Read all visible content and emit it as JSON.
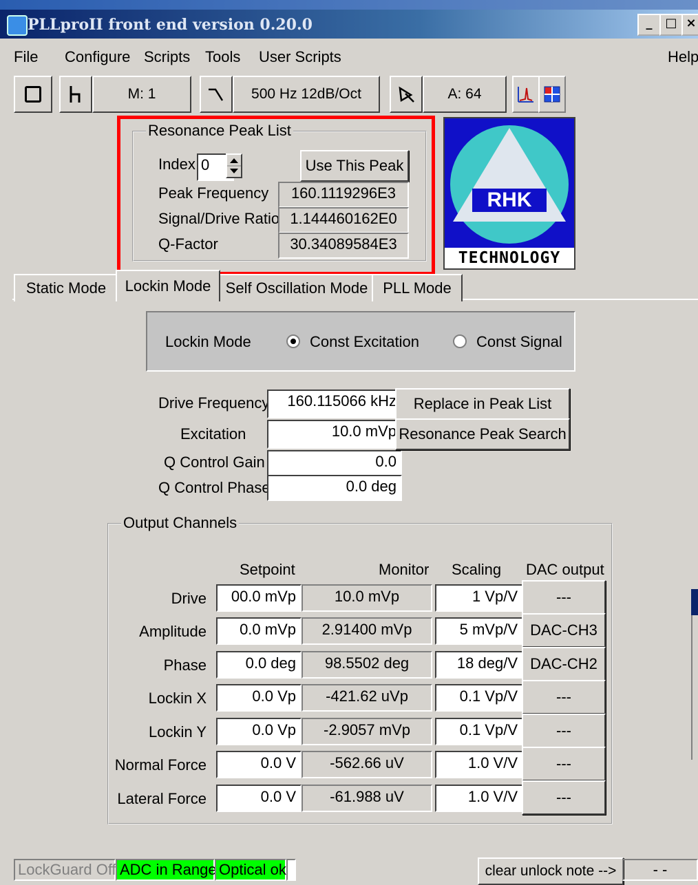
{
  "window": {
    "title": "PLLproII front end version 0.20.0"
  },
  "menu": [
    "File",
    "Configure",
    "Scripts",
    "Tools",
    "User Scripts"
  ],
  "menu_help": "Help",
  "toolbar": {
    "mode": "M: 1",
    "filter": "500 Hz 12dB/Oct",
    "amp": "A: 64"
  },
  "peaklist": {
    "title": "Resonance Peak List",
    "index_label": "Index",
    "index_value": "0",
    "use_button": "Use This Peak",
    "rows": [
      {
        "label": "Peak Frequency",
        "value": "160.1119296E3"
      },
      {
        "label": "Signal/Drive Ratio",
        "value": "1.144460162E0"
      },
      {
        "label": "Q-Factor",
        "value": "30.34089584E3"
      }
    ]
  },
  "logo": {
    "text": "RHK",
    "sub": "TECHNOLOGY"
  },
  "tabs": [
    "Static Mode",
    "Lockin Mode",
    "Self Oscillation Mode",
    "PLL Mode"
  ],
  "lockin": {
    "label": "Lockin Mode",
    "opt1": "Const Excitation",
    "opt2": "Const Signal"
  },
  "params": [
    {
      "label": "Drive Frequency",
      "value": "160.115066 kHz"
    },
    {
      "label": "Excitation",
      "value": "10.0 mVp"
    },
    {
      "label": "Q Control Gain",
      "value": "0.0"
    },
    {
      "label": "Q Control Phase",
      "value": "0.0 deg"
    }
  ],
  "replace_button": "Replace in Peak List",
  "search_button": "Resonance Peak Search",
  "output": {
    "title": "Output Channels",
    "headers": [
      "Setpoint",
      "Monitor",
      "Scaling",
      "DAC output"
    ],
    "rows": [
      {
        "name": "Drive",
        "setpoint": "00.0 mVp",
        "monitor": "10.0 mVp",
        "scaling": "1 Vp/V",
        "dac": "---"
      },
      {
        "name": "Amplitude",
        "setpoint": "0.0 mVp",
        "monitor": "2.91400 mVp",
        "scaling": "5 mVp/V",
        "dac": "DAC-CH3"
      },
      {
        "name": "Phase",
        "setpoint": "0.0 deg",
        "monitor": "98.5502 deg",
        "scaling": "18 deg/V",
        "dac": "DAC-CH2"
      },
      {
        "name": "Lockin X",
        "setpoint": "0.0 Vp",
        "monitor": "-421.62 uVp",
        "scaling": "0.1 Vp/V",
        "dac": "---"
      },
      {
        "name": "Lockin Y",
        "setpoint": "0.0 Vp",
        "monitor": "-2.9057 mVp",
        "scaling": "0.1 Vp/V",
        "dac": "---"
      },
      {
        "name": "Normal Force",
        "setpoint": "0.0 V",
        "monitor": "-562.66 uV",
        "scaling": "1.0 V/V",
        "dac": "---"
      },
      {
        "name": "Lateral Force",
        "setpoint": "0.0 V",
        "monitor": "-61.988 uV",
        "scaling": "1.0 V/V",
        "dac": "---"
      }
    ]
  },
  "status": {
    "lockguard": "LockGuard Off",
    "adc": "ADC in Range",
    "optical": "Optical ok",
    "clear": "clear unlock note -->",
    "tail": "- -"
  }
}
